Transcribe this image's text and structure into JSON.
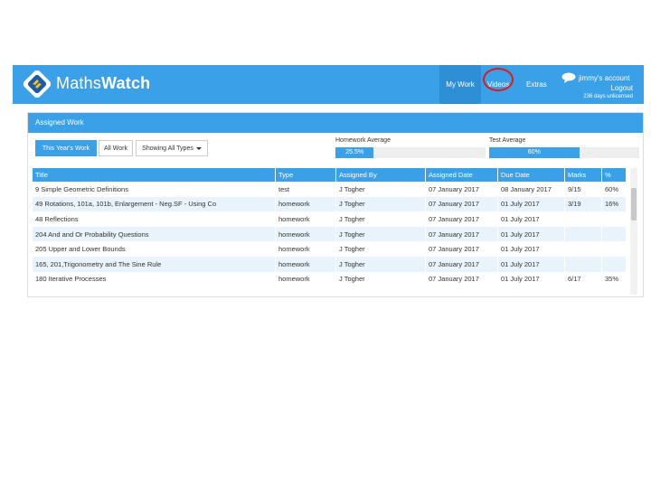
{
  "navbar": {
    "brand_part1": "Maths",
    "brand_part2": "Watch",
    "items": [
      {
        "label": "My Work"
      },
      {
        "label": "Videos"
      },
      {
        "label": "Extras"
      }
    ],
    "account": "jimmy's account",
    "logout": "Logout",
    "license_note": "236 days unlicensed"
  },
  "panel": {
    "title": "Assigned Work",
    "filters": {
      "this_year": "This Year's Work",
      "all_work": "All Work",
      "showing": "Showing All Types"
    },
    "homework_average": {
      "label": "Homework Average",
      "value": "25.5%",
      "percent": 25.5
    },
    "test_average": {
      "label": "Test Average",
      "value": "60%",
      "percent": 60
    }
  },
  "table": {
    "headers": [
      "Title",
      "Type",
      "Assigned By",
      "Assigned Date",
      "Due Date",
      "Marks",
      "%"
    ],
    "rows": [
      [
        "9 Simple Geometric Definitions",
        "test",
        "J Togher",
        "07 January 2017",
        "08 January 2017",
        "9/15",
        "60%"
      ],
      [
        "49 Rotations, 101a, 101b, Enlargement - Neg.SF - Using Co",
        "homework",
        "J Togher",
        "07 January 2017",
        "01 July 2017",
        "3/19",
        "16%"
      ],
      [
        "48 Reflections",
        "homework",
        "J Togher",
        "07 January 2017",
        "01 July 2017",
        "",
        ""
      ],
      [
        "204 And and Or Probability Questions",
        "homework",
        "J Togher",
        "07 January 2017",
        "01 July 2017",
        "",
        ""
      ],
      [
        "205 Upper and Lower Bounds",
        "homework",
        "J Togher",
        "07 January 2017",
        "01 July 2017",
        "",
        ""
      ],
      [
        "165, 201,Trigonometry and The Sine Rule",
        "homework",
        "J Togher",
        "07 January 2017",
        "01 July 2017",
        "",
        ""
      ],
      [
        "180 Iterative Processes",
        "homework",
        "J Togher",
        "07 January 2017",
        "01 July 2017",
        "6/17",
        "35%"
      ]
    ]
  },
  "colors": {
    "accent": "#3aa0e8",
    "highlight_circle": "#e01a1a"
  }
}
